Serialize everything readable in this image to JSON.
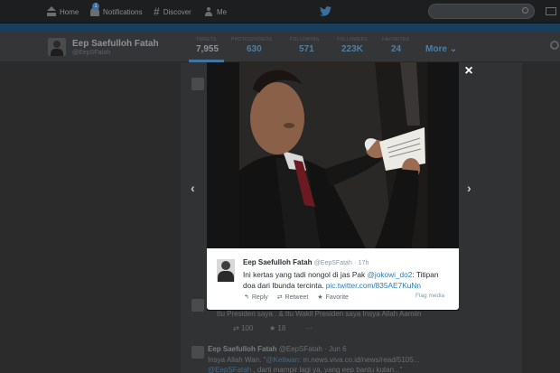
{
  "topnav": {
    "home": "Home",
    "notifications": "Notifications",
    "notifications_count": "1",
    "discover": "Discover",
    "me": "Me",
    "search_placeholder": ""
  },
  "profile": {
    "name": "Eep Saefulloh Fatah",
    "handle": "@EepSFatah",
    "stats": [
      {
        "label": "TWEETS",
        "value": "7,955"
      },
      {
        "label": "PHOTOS/VIDEOS",
        "value": "630"
      },
      {
        "label": "FOLLOWING",
        "value": "571"
      },
      {
        "label": "FOLLOWERS",
        "value": "223K"
      },
      {
        "label": "FAVORITES",
        "value": "24"
      }
    ],
    "more": "More"
  },
  "timeline": {
    "bg_text_1": "ttu Presiden saya . & ttu Wakil Presiden saya Insya Allah Aamiin",
    "retweets": "100",
    "favorites": "18",
    "tweet2_name": "Eep Saefulloh Fatah",
    "tweet2_handle": "@EepSFatah · Jun 6",
    "tweet2_line1_a": "Insya Allah Wan. \"",
    "tweet2_line1_mention": "@Ketiwan",
    "tweet2_line1_b": ": m.news.viva.co.id/news/read/5105...",
    "tweet2_line2_mention": "@EepSFatah",
    "tweet2_line2_b": " , darti mampir lagi ya, yang eep bantu kutan...\""
  },
  "modal": {
    "close": "×",
    "prev": "‹",
    "next": "›",
    "tweet": {
      "name": "Eep Saefulloh Fatah",
      "handle": "@EepSFatah",
      "time": "17h",
      "text_a": "Ini kertas yang tadi nongol di jas Pak ",
      "mention": "@jokowi_do2",
      "text_b": ": Titipan doa dari Ibunda tercinta. ",
      "link": "pic.twitter.com/835AE7KuNn",
      "reply": "Reply",
      "retweet": "Retweet",
      "favorite": "Favorite",
      "flag": "Flag media"
    }
  },
  "colors": {
    "accent": "#2b7bb9",
    "overlay_bg": "#2b2b2b",
    "banner": "#1a3f5c"
  }
}
